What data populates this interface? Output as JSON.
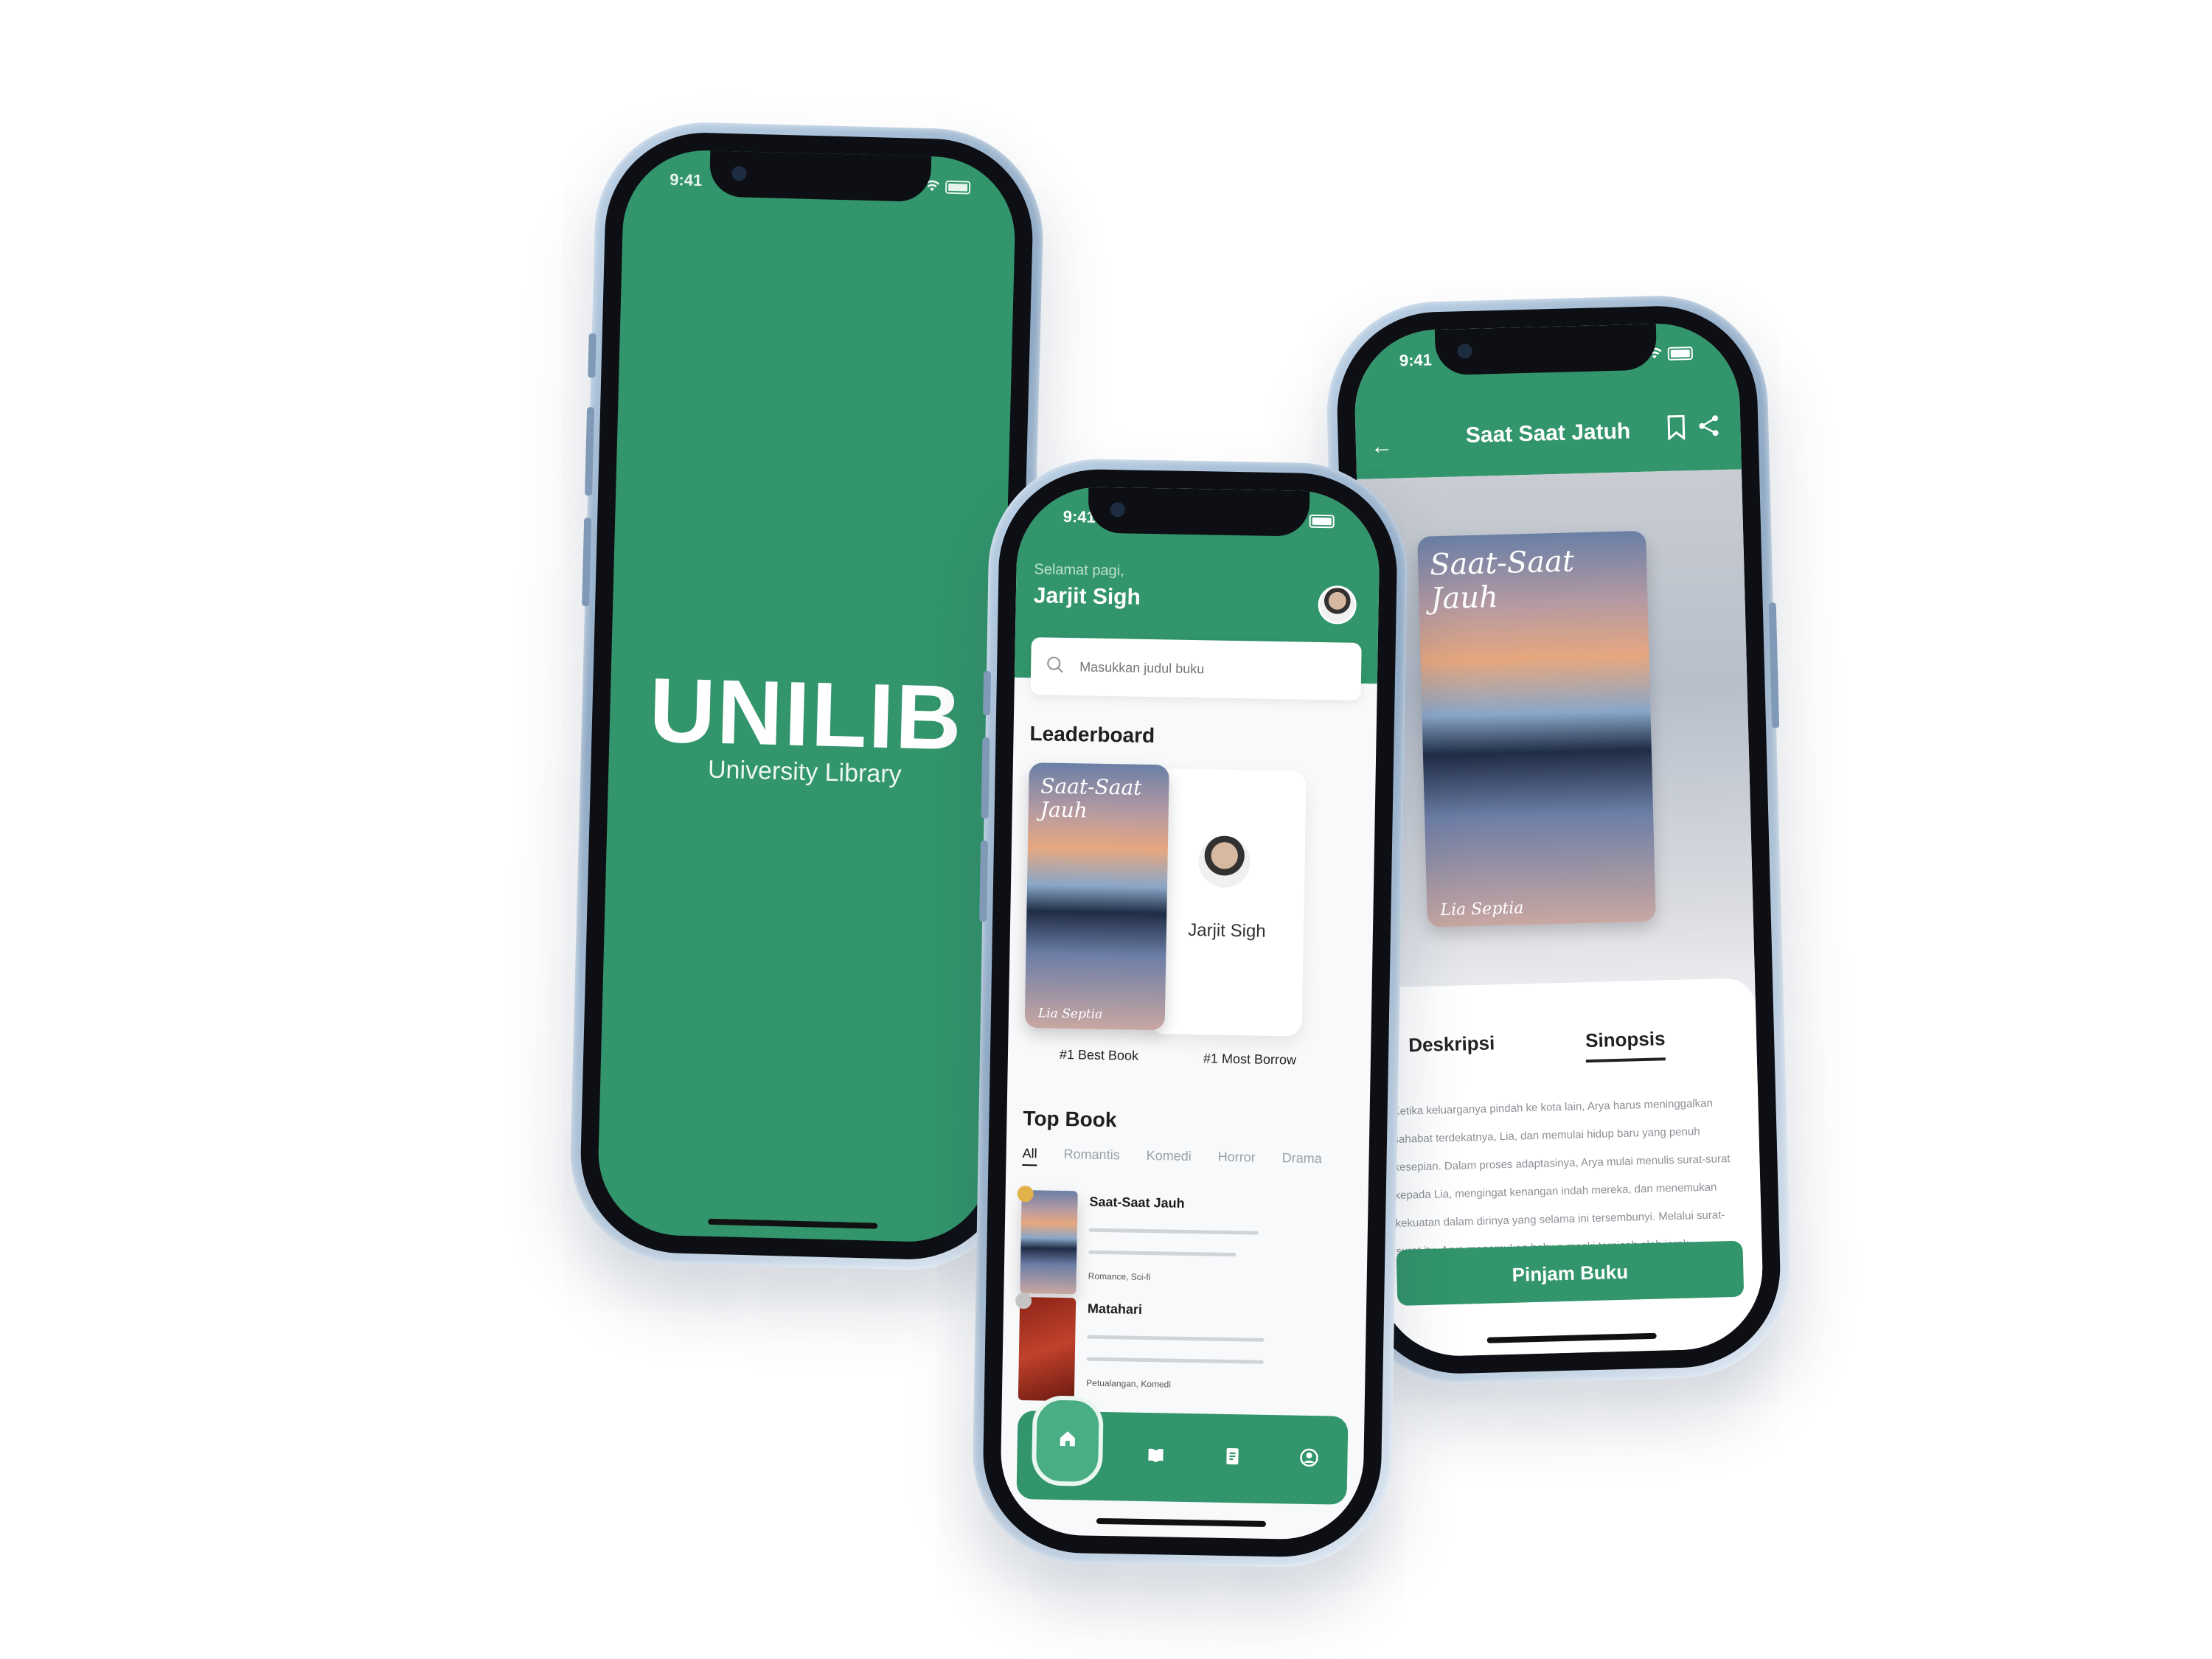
{
  "status": {
    "time": "9:41"
  },
  "splash": {
    "title": "UNILIB",
    "subtitle": "University Library"
  },
  "home": {
    "greeting": "Selamat pagi,",
    "user_name": "Jarjit Sigh",
    "search_placeholder": "Masukkan judul buku",
    "leaderboard_title": "Leaderboard",
    "best_book_label": "#1 Best Book",
    "best_book": {
      "title": "Saat-Saat Jauh",
      "author": "Lia Septia"
    },
    "most_borrow_name": "Jarjit Sigh",
    "most_borrow_label": "#1 Most Borrow",
    "top_book_title": "Top Book",
    "categories": [
      "All",
      "Romantis",
      "Komedi",
      "Horror",
      "Drama"
    ],
    "top_books": [
      {
        "title": "Saat-Saat Jauh",
        "meta": "Romance, Sci-fi",
        "badge_color": "#e3b34a"
      },
      {
        "title": "Matahari",
        "meta": "Petualangan, Komedi",
        "badge_color": "#c4c4c4"
      }
    ]
  },
  "detail": {
    "title": "Saat Saat Jatuh",
    "cover": {
      "title": "Saat-Saat Jauh",
      "author": "Lia Septia"
    },
    "tabs": [
      "Deskripsi",
      "Sinopsis"
    ],
    "synopsis": "Ketika keluarganya pindah ke kota lain, Arya harus meninggalkan sahabat terdekatnya, Lia, dan memulai hidup baru yang penuh kesepian. Dalam proses adaptasinya, Arya mulai menulis surat-surat kepada Lia, mengingat kenangan indah mereka, dan menemukan kekuatan dalam dirinya yang selama ini tersembunyi. Melalui surat-surat itu, Arya menemukan bahwa meski terpisah oleh jarak",
    "borrow_button": "Pinjam Buku"
  },
  "colors": {
    "primary": "#32956b",
    "primary_light": "#4aae84",
    "frame": "#8fa9c4"
  },
  "icons": [
    "search-icon",
    "home-icon",
    "book-icon",
    "document-icon",
    "profile-icon",
    "back-arrow-icon",
    "bookmark-icon",
    "share-icon"
  ]
}
